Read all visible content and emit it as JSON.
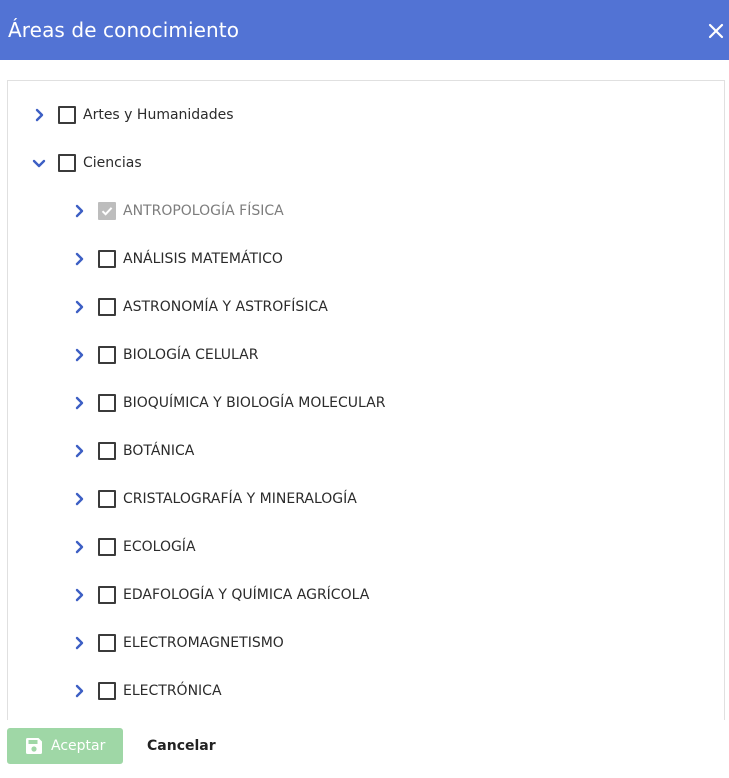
{
  "dialog": {
    "title": "Áreas de conocimiento",
    "close_icon": "close-icon"
  },
  "tree": {
    "items": [
      {
        "label": "Artes y Humanidades",
        "level": 0,
        "expanded": false,
        "checked": false,
        "disabled": false
      },
      {
        "label": "Ciencias",
        "level": 0,
        "expanded": true,
        "checked": false,
        "disabled": false
      },
      {
        "label": "ANTROPOLOGÍA FÍSICA",
        "level": 1,
        "expanded": false,
        "checked": true,
        "disabled": true
      },
      {
        "label": "ANÁLISIS MATEMÁTICO",
        "level": 1,
        "expanded": false,
        "checked": false,
        "disabled": false
      },
      {
        "label": "ASTRONOMÍA Y ASTROFÍSICA",
        "level": 1,
        "expanded": false,
        "checked": false,
        "disabled": false
      },
      {
        "label": "BIOLOGÍA CELULAR",
        "level": 1,
        "expanded": false,
        "checked": false,
        "disabled": false
      },
      {
        "label": "BIOQUÍMICA Y BIOLOGÍA MOLECULAR",
        "level": 1,
        "expanded": false,
        "checked": false,
        "disabled": false
      },
      {
        "label": "BOTÁNICA",
        "level": 1,
        "expanded": false,
        "checked": false,
        "disabled": false
      },
      {
        "label": "CRISTALOGRAFÍA Y MINERALOGÍA",
        "level": 1,
        "expanded": false,
        "checked": false,
        "disabled": false
      },
      {
        "label": "ECOLOGÍA",
        "level": 1,
        "expanded": false,
        "checked": false,
        "disabled": false
      },
      {
        "label": "EDAFOLOGÍA Y QUÍMICA AGRÍCOLA",
        "level": 1,
        "expanded": false,
        "checked": false,
        "disabled": false
      },
      {
        "label": "ELECTROMAGNETISMO",
        "level": 1,
        "expanded": false,
        "checked": false,
        "disabled": false
      },
      {
        "label": "ELECTRÓNICA",
        "level": 1,
        "expanded": false,
        "checked": false,
        "disabled": false
      }
    ]
  },
  "footer": {
    "accept_label": "Aceptar",
    "accept_icon": "save-icon",
    "cancel_label": "Cancelar"
  },
  "colors": {
    "header_bg": "#5273d4",
    "accent": "#3d5fc4",
    "accept_bg": "#9fd7a6",
    "checked_disabled": "#bdbdbd"
  }
}
